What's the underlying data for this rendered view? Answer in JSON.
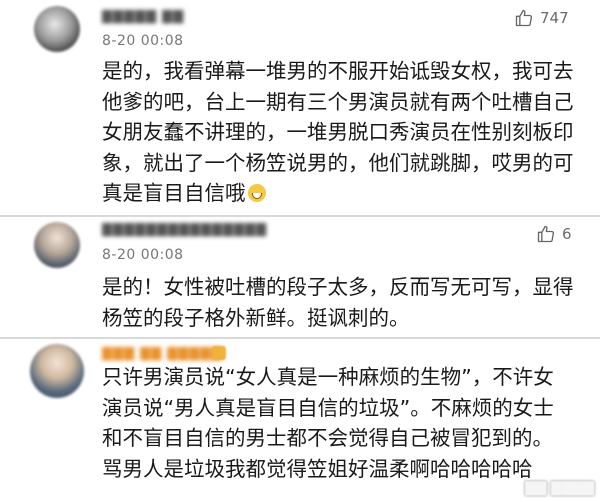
{
  "comments": [
    {
      "username": "",
      "time": "8-20 00:08",
      "likes": "747",
      "text": "是的，我看弹幕一堆男的不服开始诋毁女权，我可去\n他爹的吧，台上一期有三个男演员就有两个吐槽自己\n女朋友蠢不讲理的，一堆男脱口秀演员在性别刻板印\n象，就出了一个杨笠说男的，他们就跳脚，哎男的可\n真是盲目自信哦"
    },
    {
      "username": "",
      "time": "8-20 00:08",
      "likes": "6",
      "text": "是的！女性被吐槽的段子太多，反而写无可写，显得\n杨笠的段子格外新鲜。挺讽刺的。"
    },
    {
      "username": "",
      "text": "只许男演员说“女人真是一种麻烦的生物”，不许女\n演员说“男人真是盲目自信的垃圾”。不麻烦的女士\n和不盲目自信的男士都不会觉得自己被冒犯到的。\n骂男人是垃圾我都觉得笠姐好温柔啊哈哈哈哈哈"
    }
  ],
  "colors": {
    "vip_name": "#e8922c",
    "time": "#777777"
  },
  "icons": {
    "like": "thumbs-up-icon",
    "emoji": "grin-emoji-icon"
  }
}
